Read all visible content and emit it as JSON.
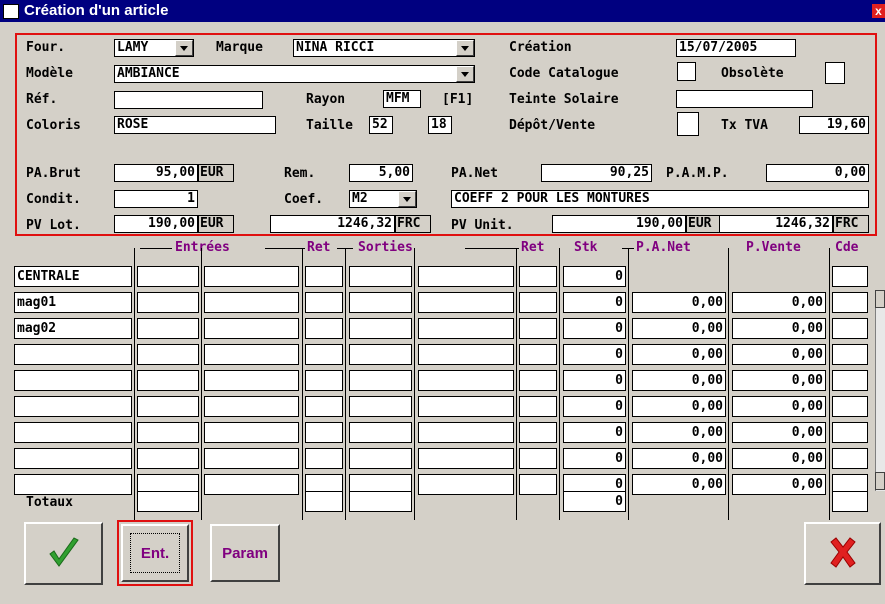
{
  "window": {
    "title": "Création d'un article",
    "close_glyph": "x"
  },
  "article": {
    "four_label": "Four.",
    "four_value": "LAMY",
    "marque_label": "Marque",
    "marque_value": "NINA RICCI",
    "creation_label": "Création",
    "creation_value": "15/07/2005",
    "modele_label": "Modèle",
    "modele_value": "AMBIANCE",
    "code_catalogue_label": "Code Catalogue",
    "obsolete_label": "Obsolète",
    "ref_label": "Réf.",
    "ref_value": "",
    "rayon_label": "Rayon",
    "rayon_value": "MFM",
    "rayon_code": "[F1]",
    "teinte_label": "Teinte Solaire",
    "teinte_value": "",
    "coloris_label": "Coloris",
    "coloris_value": "ROSE",
    "taille_label": "Taille",
    "taille_1": "52",
    "taille_2": "18",
    "depot_label": "Dépôt/Vente",
    "tva_label": "Tx TVA",
    "tva_value": "19,60"
  },
  "pricing": {
    "pa_brut_label": "PA.Brut",
    "pa_brut_value": "95,00",
    "pa_brut_currency": "EUR",
    "rem_label": "Rem.",
    "rem_value": "5,00",
    "pa_net_label": "PA.Net",
    "pa_net_value": "90,25",
    "pamp_label": "P.A.M.P.",
    "pamp_value": "0,00",
    "condit_label": "Condit.",
    "condit_value": "1",
    "coef_label": "Coef.",
    "coef_value": "M2",
    "coef_desc": "COEFF 2 POUR LES MONTURES",
    "pv_lot_label": "PV Lot.",
    "pv_lot_value": "190,00",
    "pv_lot_currency": "EUR",
    "pv_lot_frc_value": "1246,32",
    "pv_lot_frc_currency": "FRC",
    "pv_unit_label": "PV Unit.",
    "pv_unit_value": "190,00",
    "pv_unit_currency": "EUR",
    "pv_unit_frc_value": "1246,32",
    "pv_unit_frc_currency": "FRC"
  },
  "grid": {
    "headers": {
      "entrees": "Entrées",
      "ret1": "Ret",
      "sorties": "Sorties",
      "ret2": "Ret",
      "stk": "Stk",
      "pa_net": "P.A.Net",
      "p_vente": "P.Vente",
      "cde": "Cde"
    },
    "rows": [
      {
        "name": "CENTRALE",
        "stk": "0",
        "pa_net": "",
        "p_vente": ""
      },
      {
        "name": "mag01",
        "stk": "0",
        "pa_net": "0,00",
        "p_vente": "0,00"
      },
      {
        "name": "mag02",
        "stk": "0",
        "pa_net": "0,00",
        "p_vente": "0,00"
      },
      {
        "name": "",
        "stk": "0",
        "pa_net": "0,00",
        "p_vente": "0,00"
      },
      {
        "name": "",
        "stk": "0",
        "pa_net": "0,00",
        "p_vente": "0,00"
      },
      {
        "name": "",
        "stk": "0",
        "pa_net": "0,00",
        "p_vente": "0,00"
      },
      {
        "name": "",
        "stk": "0",
        "pa_net": "0,00",
        "p_vente": "0,00"
      },
      {
        "name": "",
        "stk": "0",
        "pa_net": "0,00",
        "p_vente": "0,00"
      },
      {
        "name": "",
        "stk": "0",
        "pa_net": "0,00",
        "p_vente": "0,00"
      }
    ],
    "totaux_label": "Totaux",
    "totaux_stk": "0"
  },
  "buttons": {
    "ent_label": "Ent.",
    "param_label": "Param"
  },
  "colors": {
    "title_bar": "#000080",
    "accent_purple": "#800080",
    "highlight_red": "#e01010",
    "ok_green": "#30a030",
    "cancel_red": "#e02020"
  }
}
